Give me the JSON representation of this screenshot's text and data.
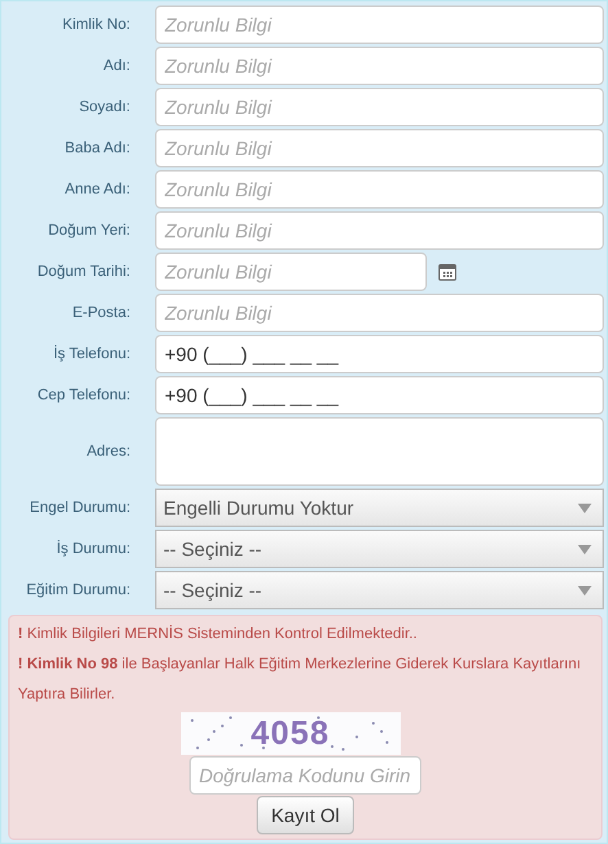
{
  "form": {
    "fields": [
      {
        "kind": "text",
        "label": "Kimlik No:",
        "placeholder": "Zorunlu Bilgi"
      },
      {
        "kind": "text",
        "label": "Adı:",
        "placeholder": "Zorunlu Bilgi"
      },
      {
        "kind": "text",
        "label": "Soyadı:",
        "placeholder": "Zorunlu Bilgi"
      },
      {
        "kind": "text",
        "label": "Baba Adı:",
        "placeholder": "Zorunlu Bilgi"
      },
      {
        "kind": "text",
        "label": "Anne Adı:",
        "placeholder": "Zorunlu Bilgi"
      },
      {
        "kind": "text",
        "label": "Doğum Yeri:",
        "placeholder": "Zorunlu Bilgi"
      },
      {
        "kind": "date",
        "label": "Doğum Tarihi:",
        "placeholder": "Zorunlu Bilgi"
      },
      {
        "kind": "text",
        "label": "E-Posta:",
        "placeholder": "Zorunlu Bilgi"
      },
      {
        "kind": "text",
        "label": "İş Telefonu:",
        "value": "+90 (___) ___ __ __"
      },
      {
        "kind": "text",
        "label": "Cep Telefonu:",
        "value": "+90 (___) ___ __ __"
      },
      {
        "kind": "textarea",
        "label": "Adres:"
      },
      {
        "kind": "select",
        "label": "Engel Durumu:",
        "value": "Engelli Durumu Yoktur"
      },
      {
        "kind": "select",
        "label": "İş Durumu:",
        "value": "-- Seçiniz --"
      },
      {
        "kind": "select",
        "label": "Eğitim Durumu:",
        "value": "-- Seçiniz --"
      }
    ]
  },
  "alert": {
    "messages": [
      "**!** Kimlik Bilgileri MERNİS Sisteminden Kontrol Edilmektedir..",
      "**! Kimlik No 98** ile Başlayanlar Halk Eğitim Merkezlerine Giderek Kurslara Kayıtlarını Yaptıra Bilirler."
    ],
    "captcha": {
      "code": "4058"
    },
    "verification": {
      "placeholder": "Doğrulama Kodunu Girin"
    },
    "submit": "Kayıt Ol"
  }
}
